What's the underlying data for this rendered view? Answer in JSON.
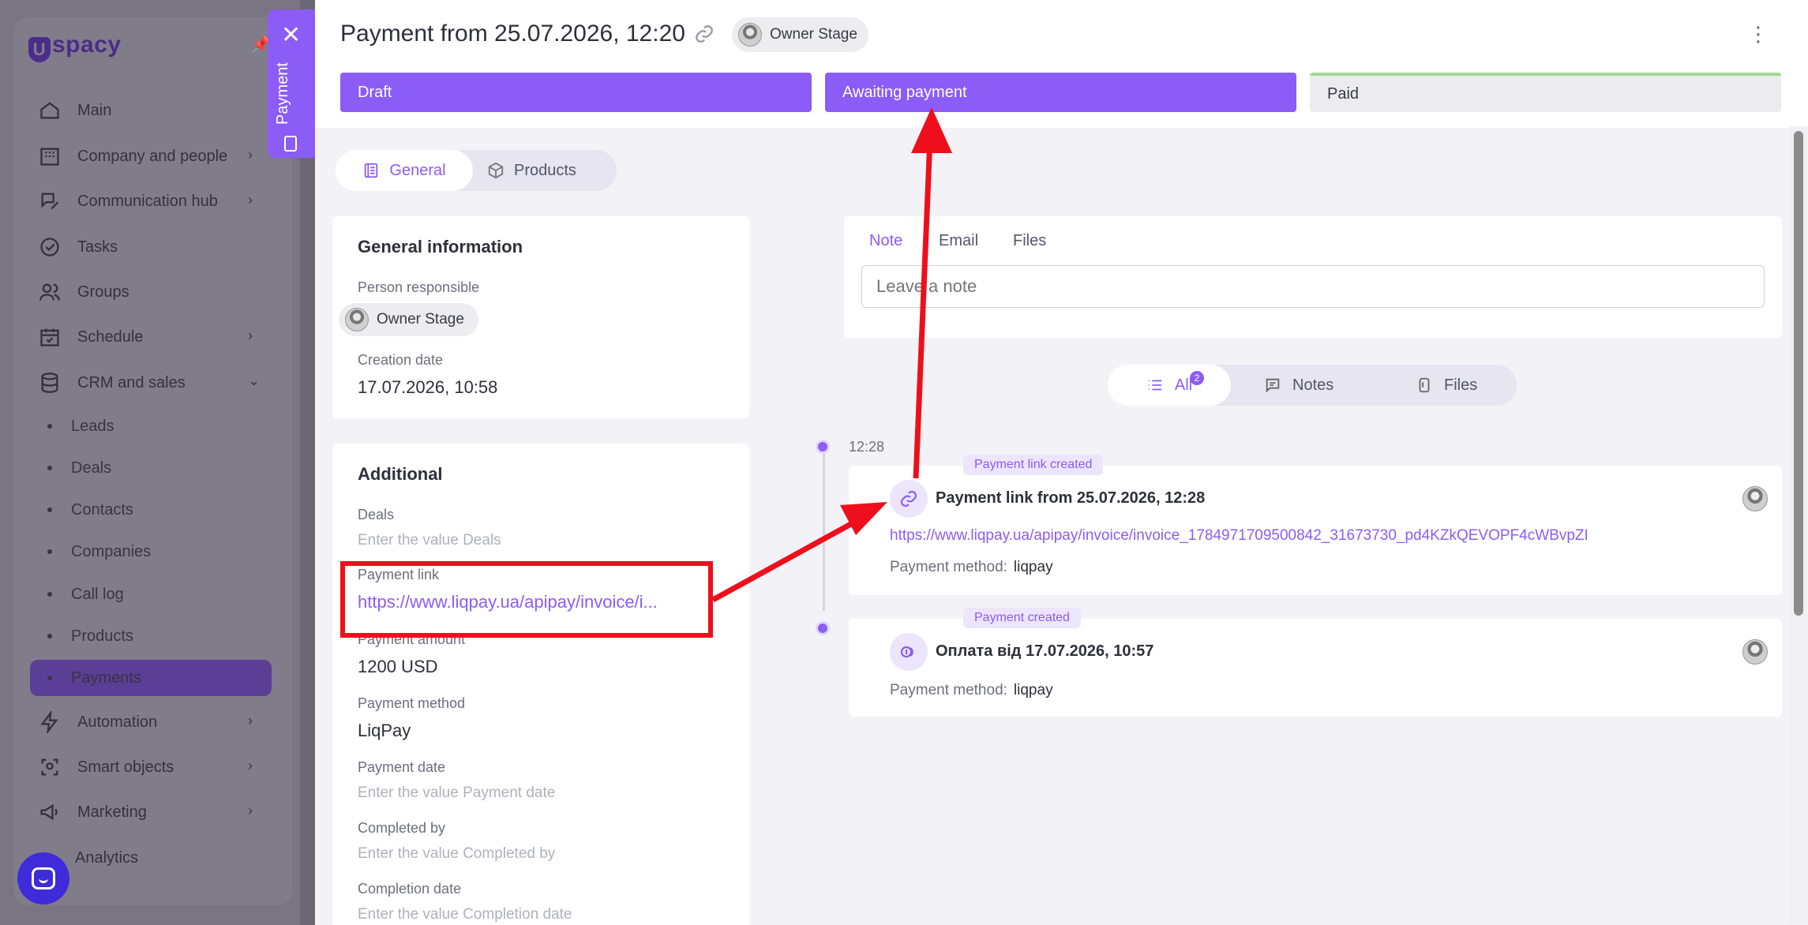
{
  "sidebar": {
    "logo": "spacy",
    "items": [
      {
        "label": "Main",
        "icon": "home-icon",
        "chevron": false
      },
      {
        "label": "Company and people",
        "icon": "building-icon",
        "chevron": true
      },
      {
        "label": "Communication hub",
        "icon": "chat-edit-icon",
        "chevron": true
      },
      {
        "label": "Tasks",
        "icon": "check-circle-icon",
        "chevron": false
      },
      {
        "label": "Groups",
        "icon": "users-icon",
        "chevron": false
      },
      {
        "label": "Schedule",
        "icon": "calendar-icon",
        "chevron": true
      },
      {
        "label": "CRM and sales",
        "icon": "database-icon",
        "chevron": "down"
      }
    ],
    "crm_sub": [
      "Leads",
      "Deals",
      "Contacts",
      "Companies",
      "Call log",
      "Products",
      "Payments"
    ],
    "items_after": [
      {
        "label": "Automation",
        "icon": "lightning-icon",
        "chevron": true
      },
      {
        "label": "Smart objects",
        "icon": "scan-icon",
        "chevron": true
      },
      {
        "label": "Marketing",
        "icon": "megaphone-icon",
        "chevron": true
      },
      {
        "label": "Analytics",
        "icon": "chart-icon",
        "chevron": false
      }
    ]
  },
  "side_tab": {
    "label": "Payment"
  },
  "header": {
    "title": "Payment from 25.07.2026, 12:20",
    "owner": "Owner Stage",
    "stages": [
      {
        "label": "Draft",
        "state": "filled"
      },
      {
        "label": "Awaiting payment",
        "state": "filled"
      },
      {
        "label": "Paid",
        "state": "empty"
      }
    ]
  },
  "tabs": {
    "general": "General",
    "products": "Products"
  },
  "general_info": {
    "title": "General information",
    "person_label": "Person responsible",
    "person": "Owner Stage",
    "creation_label": "Creation date",
    "creation_value": "17.07.2026, 10:58"
  },
  "additional": {
    "title": "Additional",
    "deals_label": "Deals",
    "deals_placeholder": "Enter the value Deals",
    "link_label": "Payment link",
    "link_value": "https://www.liqpay.ua/apipay/invoice/i...",
    "amount_label": "Payment amount",
    "amount_value": "1200 USD",
    "method_label": "Payment method",
    "method_value": "LiqPay",
    "date_label": "Payment date",
    "date_placeholder": "Enter the value Payment date",
    "completed_label": "Completed by",
    "completed_placeholder": "Enter the value Completed by",
    "completion_label": "Completion date",
    "completion_placeholder": "Enter the value Completion date"
  },
  "composer": {
    "tabs": [
      "Note",
      "Email",
      "Files"
    ],
    "placeholder": "Leave a note"
  },
  "filter": {
    "all": "All",
    "all_count": "2",
    "notes": "Notes",
    "files": "Files"
  },
  "timeline": {
    "time": "12:28",
    "events": [
      {
        "tag": "Payment link created",
        "title": "Payment link from 25.07.2026, 12:28",
        "url": "https://www.liqpay.ua/apipay/invoice/invoice_1784971709500842_31673730_pd4KZkQEVOPF4cWBvpZI",
        "method_label": "Payment method:",
        "method_value": "liqpay"
      },
      {
        "tag": "Payment created",
        "title": "Оплата від 17.07.2026, 10:57",
        "method_label": "Payment method:",
        "method_value": "liqpay"
      }
    ]
  },
  "colors": {
    "accent": "#8b5cf6",
    "annotation_red": "#ef0f1c",
    "paid_bar": "#9fdc8f"
  }
}
